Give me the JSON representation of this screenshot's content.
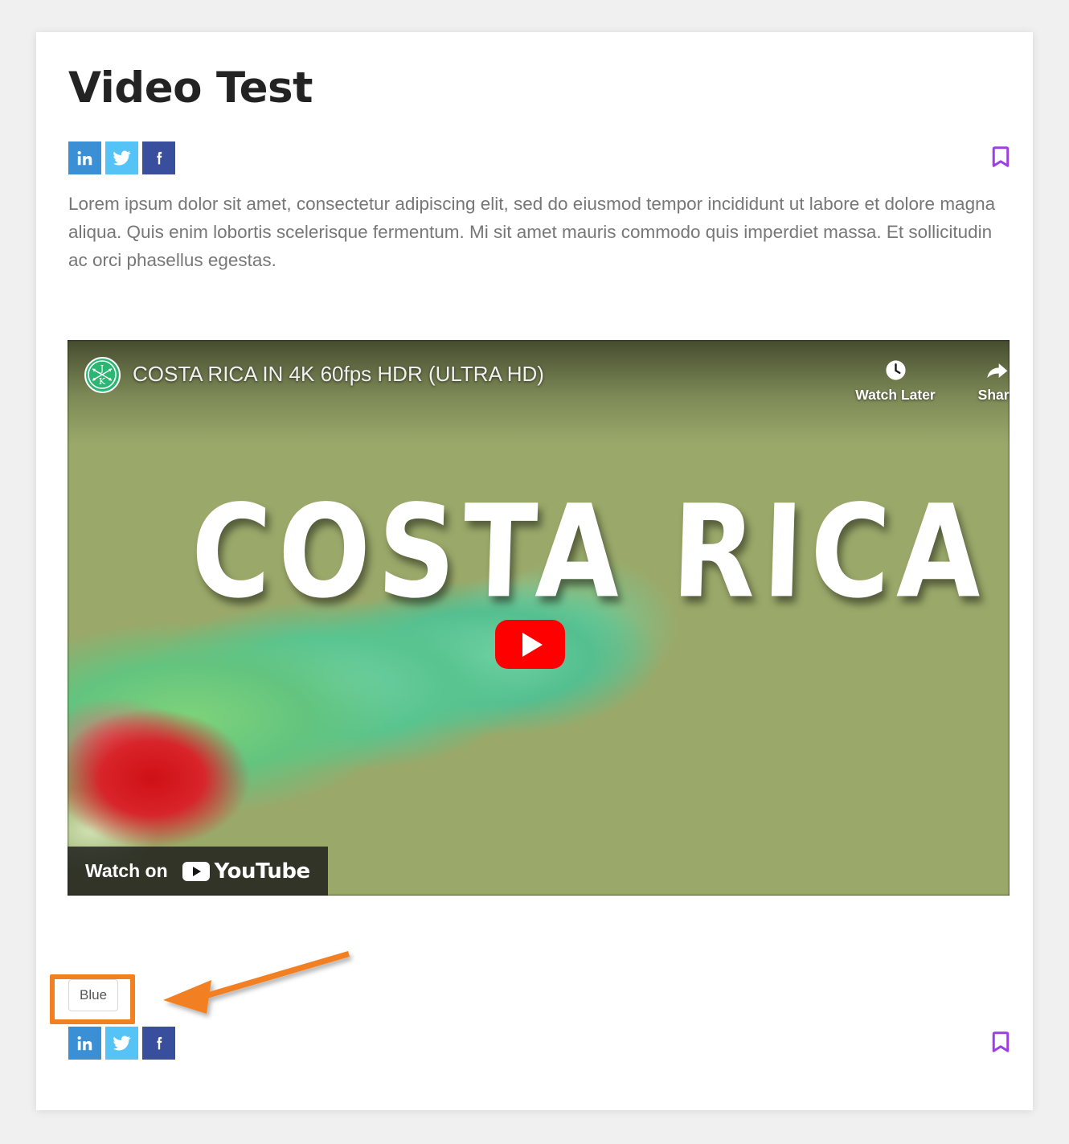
{
  "page": {
    "background_color": "#f0f0f0",
    "card_background": "#ffffff",
    "title": "Video Test",
    "body_paragraph": "Lorem ipsum dolor sit amet, consectetur adipiscing elit, sed do eiusmod tempor incididunt ut labore et dolore magna aliqua. Quis enim lobortis scelerisque fermentum. Mi sit amet mauris commodo quis imperdiet massa. Et sollicitudin ac orci phasellus egestas."
  },
  "share": {
    "top": [
      {
        "name": "linkedin",
        "label": "in",
        "color": "#3b8fd4"
      },
      {
        "name": "twitter",
        "label": "",
        "color": "#55c3f5"
      },
      {
        "name": "facebook",
        "label": "f",
        "color": "#394e9d"
      }
    ],
    "bottom": [
      {
        "name": "linkedin",
        "label": "in",
        "color": "#3b8fd4"
      },
      {
        "name": "twitter",
        "label": "",
        "color": "#55c3f5"
      },
      {
        "name": "facebook",
        "label": "f",
        "color": "#394e9d"
      }
    ]
  },
  "bookmark": {
    "icon": "bookmark-icon",
    "color": "#9c3fe4"
  },
  "video": {
    "channel_avatar_initials": "JK",
    "channel_avatar_color": "#2cb673",
    "title": "COSTA RICA IN 4K 60fps HDR (ULTRA HD)",
    "overlay_text": "COSTA RICA",
    "actions": [
      {
        "name": "watch-later",
        "label": "Watch Later",
        "icon": "clock-icon"
      },
      {
        "name": "share",
        "label": "Share",
        "icon": "share-arrow-icon"
      }
    ],
    "play_button": {
      "icon": "play-icon",
      "color": "#ff0000"
    },
    "watch_on": {
      "text": "Watch on",
      "brand": "YouTube",
      "icon": "youtube-play-icon"
    }
  },
  "tags": {
    "items": [
      {
        "label": "Blue"
      }
    ]
  },
  "annotation": {
    "highlight_color": "#f28021",
    "shape": "rectangle-and-arrow",
    "target": "Blue"
  }
}
